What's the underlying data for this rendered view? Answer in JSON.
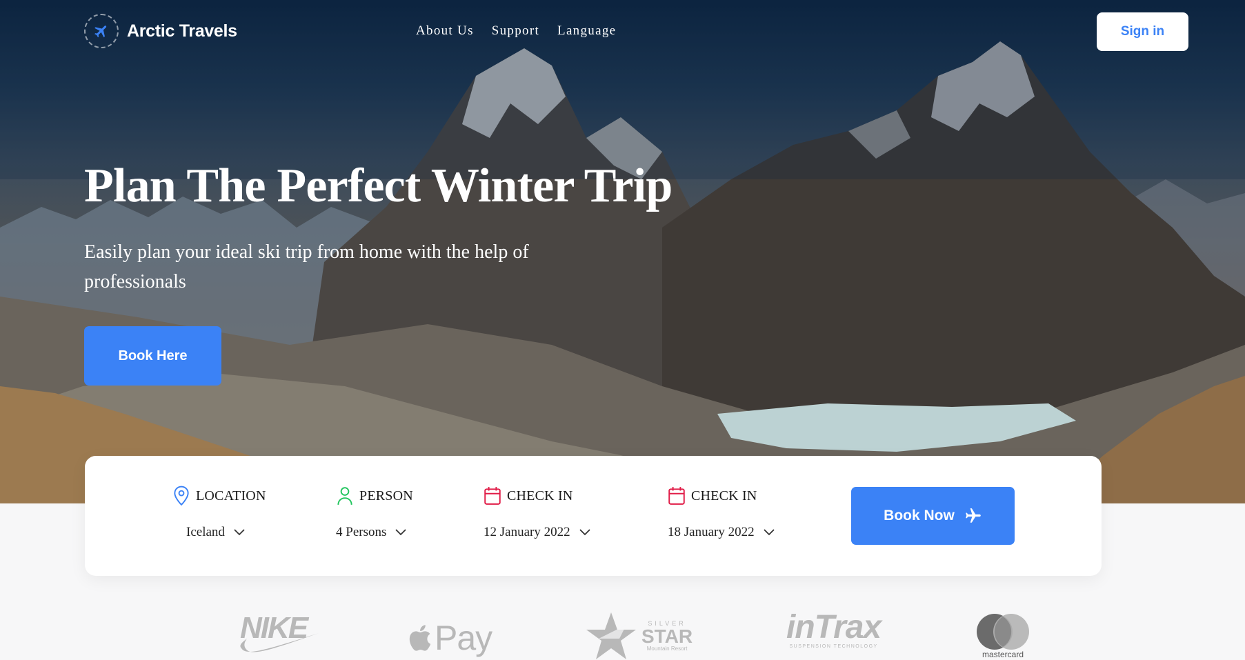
{
  "brand": {
    "name": "Arctic Travels"
  },
  "nav": {
    "links": [
      "About Us",
      "Support",
      "Language"
    ],
    "signin_label": "Sign in"
  },
  "hero": {
    "title": "Plan The Perfect Winter Trip",
    "subtitle": "Easily plan your ideal ski trip from home with the help of professionals",
    "cta_label": "Book Here"
  },
  "booking": {
    "fields": [
      {
        "label": "LOCATION",
        "value": "Iceland",
        "icon": "location-pin-icon",
        "icon_color": "#3b82f6"
      },
      {
        "label": "PERSON",
        "value": "4 Persons",
        "icon": "person-icon",
        "icon_color": "#22c55e"
      },
      {
        "label": "CHECK IN",
        "value": "12 January 2022",
        "icon": "calendar-icon",
        "icon_color": "#e11d48"
      },
      {
        "label": "CHECK IN",
        "value": "18 January 2022",
        "icon": "calendar-icon",
        "icon_color": "#e11d48"
      }
    ],
    "submit_label": "Book Now",
    "submit_icon": "airplane-icon"
  },
  "partners": {
    "nike": "NIKE",
    "applepay": "Pay",
    "silverstar_small": "SILVER",
    "silverstar_big": "STAR",
    "silverstar_tiny": "Mountain Resort",
    "intrax": "inTrax",
    "intrax_small": "SUSPENSION TECHNOLOGY",
    "mastercard": "mastercard"
  },
  "colors": {
    "accent": "#3b82f6",
    "card_bg": "#ffffff",
    "page_bg": "#f7f7f8"
  }
}
